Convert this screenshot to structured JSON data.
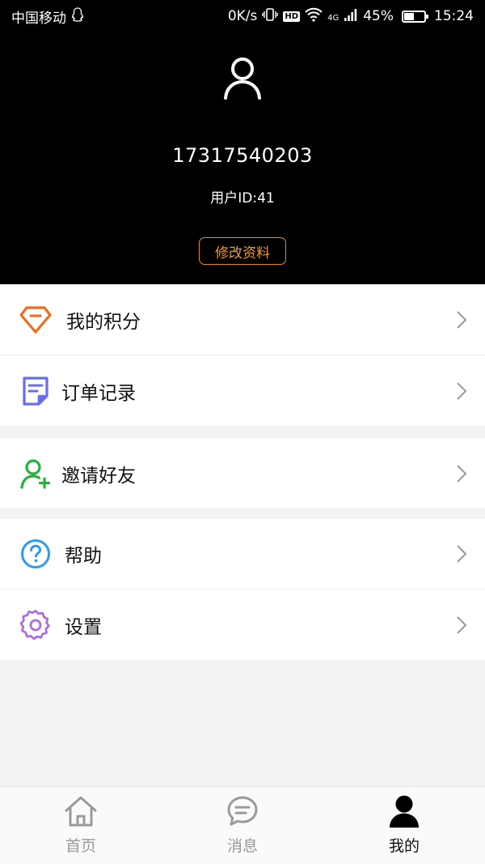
{
  "status_bar": {
    "carrier": "中国移动",
    "speed": "0K/s",
    "hd": "HD",
    "network": "4G",
    "battery": "45%",
    "battery_level": 0.45,
    "time": "15:24"
  },
  "profile": {
    "phone": "17317540203",
    "user_id": "用户ID:41",
    "edit_label": "修改资料",
    "accent_color": "#f09a2a"
  },
  "menu": {
    "group1": [
      {
        "label": "我的积分",
        "icon": "diamond-icon",
        "color": "#f26b1d"
      },
      {
        "label": "订单记录",
        "icon": "document-icon",
        "color": "#6a6cf0"
      }
    ],
    "group2": [
      {
        "label": "邀请好友",
        "icon": "add-user-icon",
        "color": "#24b33b"
      }
    ],
    "group3": [
      {
        "label": "帮助",
        "icon": "help-icon",
        "color": "#2d9cf0"
      },
      {
        "label": "设置",
        "icon": "gear-icon",
        "color": "#b06ae0"
      }
    ]
  },
  "tabs": [
    {
      "label": "首页",
      "icon": "home-icon",
      "active": false
    },
    {
      "label": "消息",
      "icon": "message-icon",
      "active": false
    },
    {
      "label": "我的",
      "icon": "user-icon",
      "active": true
    }
  ]
}
